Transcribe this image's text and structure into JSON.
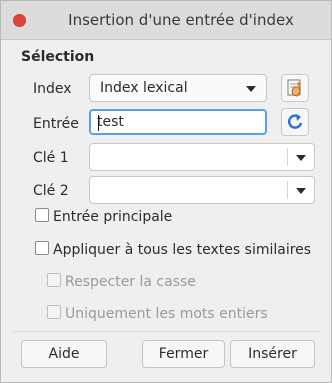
{
  "window": {
    "title": "Insertion d'une entrée d'index"
  },
  "section": {
    "title": "Sélection"
  },
  "fields": {
    "index_label": "Index",
    "index_value": "Index lexical",
    "entry_label": "Entrée",
    "entry_value": "test",
    "key1_label": "Clé 1",
    "key1_value": "",
    "key2_label": "Clé 2",
    "key2_value": ""
  },
  "checks": {
    "main_entry": "Entrée principale",
    "apply_all": "Appliquer à tous les textes similaires",
    "match_case": "Respecter la casse",
    "whole_words": "Uniquement les mots entiers"
  },
  "buttons": {
    "help": "Aide",
    "close": "Fermer",
    "insert": "Insérer"
  },
  "icons": {
    "new_index": "new-index-icon",
    "update": "refresh-icon",
    "close": "close-icon"
  },
  "colors": {
    "close": "#e0443e",
    "focus": "#5aa0e6",
    "refresh": "#2d6fd3",
    "new_index_accent": "#e8892d"
  }
}
